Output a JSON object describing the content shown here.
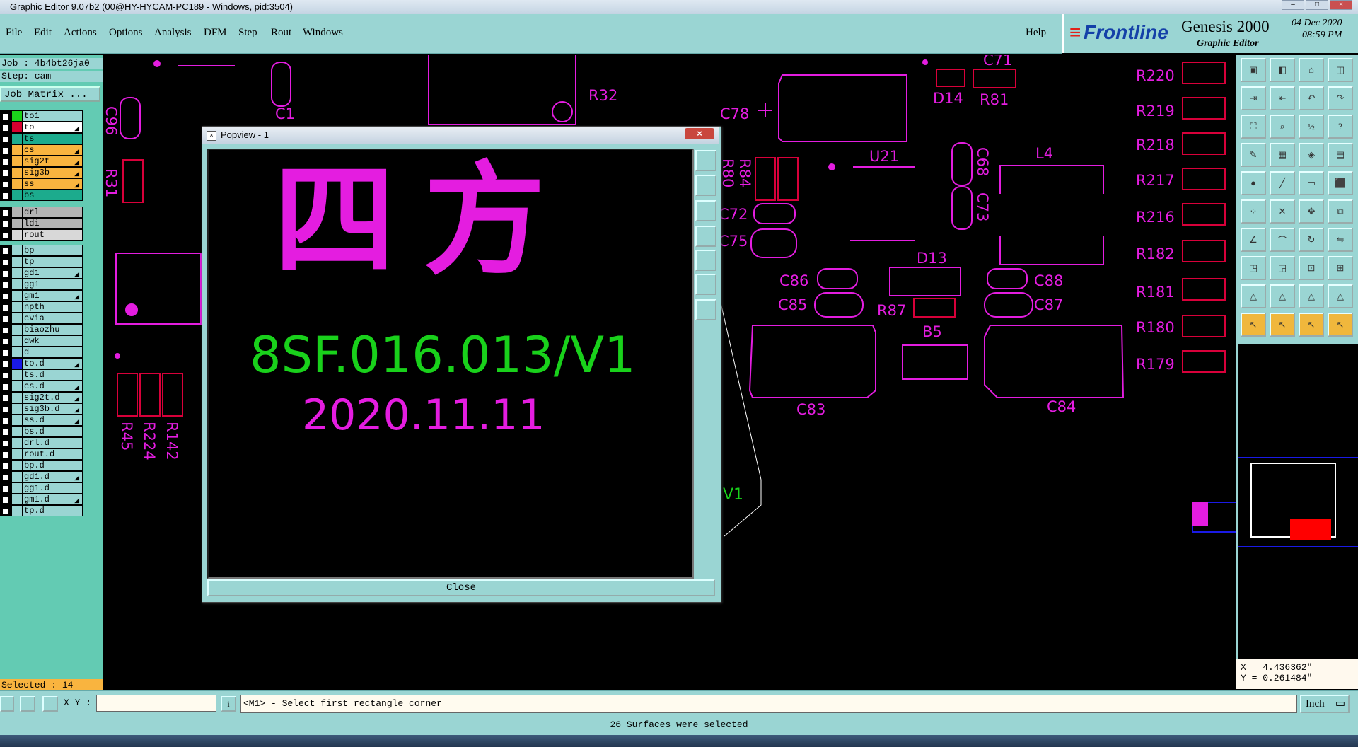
{
  "window": {
    "title": "Graphic Editor 9.07b2 (00@HY-HYCAM-PC189 - Windows, pid:3504)"
  },
  "menu": {
    "items": [
      {
        "label": "File"
      },
      {
        "label": "Edit"
      },
      {
        "label": "Actions"
      },
      {
        "label": "Options"
      },
      {
        "label": "Analysis"
      },
      {
        "label": "DFM"
      },
      {
        "label": "Step"
      },
      {
        "label": "Rout"
      },
      {
        "label": "Windows"
      }
    ],
    "help": "Help"
  },
  "brand": {
    "logo": "Frontline",
    "product": "Genesis 2000",
    "subtitle": "Graphic Editor",
    "date": "04 Dec 2020",
    "time": "08:59 PM"
  },
  "left_panel": {
    "job": "Job : 4b4bt26ja0",
    "step": "Step: cam",
    "job_matrix_button": "Job Matrix ...",
    "groups": [
      [
        {
          "name": "to1",
          "color": "#9ad5d3",
          "swatch": "#1bd11b",
          "icon": ""
        },
        {
          "name": "to",
          "color": "#ffffff",
          "swatch": "#d9002f",
          "icon": "edit",
          "active": true
        },
        {
          "name": "ts",
          "color": "#1cab8d",
          "swatch": "#1cab8d",
          "icon": ""
        },
        {
          "name": "cs",
          "color": "#f9b43f",
          "swatch": "#f9b43f",
          "icon": "edit"
        },
        {
          "name": "sig2t",
          "color": "#f9b43f",
          "swatch": "#f9b43f",
          "icon": "edit"
        },
        {
          "name": "sig3b",
          "color": "#f9b43f",
          "swatch": "#f9b43f",
          "icon": "edit"
        },
        {
          "name": "ss",
          "color": "#f9b43f",
          "swatch": "#f9b43f",
          "icon": "edit"
        },
        {
          "name": "bs",
          "color": "#1cab8d",
          "swatch": "#1cab8d",
          "icon": ""
        }
      ],
      [
        {
          "name": "drl",
          "color": "#b4b4b4",
          "swatch": "#b4b4b4",
          "icon": ""
        },
        {
          "name": "ldi",
          "color": "#b4b4b4",
          "swatch": "#b4b4b4",
          "icon": ""
        },
        {
          "name": "rout",
          "color": "#d8d8d8",
          "swatch": "#d8d8d8",
          "icon": ""
        }
      ],
      [
        {
          "name": "bp",
          "color": "#9ad5d3",
          "swatch": "#9ad5d3",
          "icon": ""
        },
        {
          "name": "tp",
          "color": "#9ad5d3",
          "swatch": "#9ad5d3",
          "icon": ""
        },
        {
          "name": "gd1",
          "color": "#9ad5d3",
          "swatch": "#9ad5d3",
          "icon": "edit"
        },
        {
          "name": "gg1",
          "color": "#9ad5d3",
          "swatch": "#9ad5d3",
          "icon": ""
        },
        {
          "name": "gm1",
          "color": "#9ad5d3",
          "swatch": "#9ad5d3",
          "icon": "edit"
        },
        {
          "name": "npth",
          "color": "#9ad5d3",
          "swatch": "#9ad5d3",
          "icon": ""
        },
        {
          "name": "cvia",
          "color": "#9ad5d3",
          "swatch": "#9ad5d3",
          "icon": ""
        },
        {
          "name": "biaozhu",
          "color": "#9ad5d3",
          "swatch": "#9ad5d3",
          "icon": ""
        },
        {
          "name": "dwk",
          "color": "#9ad5d3",
          "swatch": "#9ad5d3",
          "icon": ""
        },
        {
          "name": "d",
          "color": "#9ad5d3",
          "swatch": "#9ad5d3",
          "icon": ""
        },
        {
          "name": "to.d",
          "color": "#9ad5d3",
          "swatch": "#1a1ae6",
          "icon": "edit"
        },
        {
          "name": "ts.d",
          "color": "#9ad5d3",
          "swatch": "#9ad5d3",
          "icon": ""
        },
        {
          "name": "cs.d",
          "color": "#9ad5d3",
          "swatch": "#9ad5d3",
          "icon": "edit"
        },
        {
          "name": "sig2t.d",
          "color": "#9ad5d3",
          "swatch": "#9ad5d3",
          "icon": "edit"
        },
        {
          "name": "sig3b.d",
          "color": "#9ad5d3",
          "swatch": "#9ad5d3",
          "icon": "edit"
        },
        {
          "name": "ss.d",
          "color": "#9ad5d3",
          "swatch": "#9ad5d3",
          "icon": "edit"
        },
        {
          "name": "bs.d",
          "color": "#9ad5d3",
          "swatch": "#9ad5d3",
          "icon": ""
        },
        {
          "name": "drl.d",
          "color": "#9ad5d3",
          "swatch": "#9ad5d3",
          "icon": ""
        },
        {
          "name": "rout.d",
          "color": "#9ad5d3",
          "swatch": "#9ad5d3",
          "icon": ""
        },
        {
          "name": "bp.d",
          "color": "#9ad5d3",
          "swatch": "#9ad5d3",
          "icon": ""
        },
        {
          "name": "gd1.d",
          "color": "#9ad5d3",
          "swatch": "#9ad5d3",
          "icon": "edit"
        },
        {
          "name": "gg1.d",
          "color": "#9ad5d3",
          "swatch": "#9ad5d3",
          "icon": ""
        },
        {
          "name": "gm1.d",
          "color": "#9ad5d3",
          "swatch": "#9ad5d3",
          "icon": "edit"
        },
        {
          "name": "tp.d",
          "color": "#9ad5d3",
          "swatch": "#9ad5d3",
          "icon": ""
        }
      ]
    ],
    "selected": "Selected : 14"
  },
  "popview": {
    "title": "Popview - 1",
    "chinese_text": "四方",
    "part_number": "8SF.016.013/V1",
    "date_text": "2020.11.11",
    "close_button": "Close"
  },
  "board_labels": {
    "c1": "C1",
    "c96": "C96",
    "r31": "R31",
    "r32": "R32",
    "c78": "C78",
    "u21": "U21",
    "d14": "D14",
    "r81": "R81",
    "c71": "C71",
    "r84": "R84",
    "r80": "R80",
    "c72": "C72",
    "c75": "C75",
    "c68": "C68",
    "c73": "C73",
    "l4": "L4",
    "c86": "C86",
    "c85": "C85",
    "d13": "D13",
    "r87": "R87",
    "c88": "C88",
    "c87": "C87",
    "b5": "B5",
    "c83": "C83",
    "c84": "C84",
    "r45": "R45",
    "r224": "R224",
    "r142": "R142",
    "r220": "R220",
    "r219": "R219",
    "r218": "R218",
    "r217": "R217",
    "r216": "R216",
    "r182": "R182",
    "r181": "R181",
    "r180": "R180",
    "r179": "R179",
    "v1_fragment": "V1"
  },
  "coords": {
    "x": "X = 4.436362\"",
    "y": "Y = 0.261484\""
  },
  "bottom": {
    "xy_label": "X Y :",
    "xy_value": "",
    "prompt": "<M1> - Select first rectangle corner",
    "units": "Inch"
  },
  "status": {
    "message": "26 Surfaces were selected"
  },
  "colors": {
    "panel": "#9ad5d3",
    "board_magenta": "#e41de0",
    "board_red": "#d8003a",
    "text_green": "#19d11b"
  }
}
